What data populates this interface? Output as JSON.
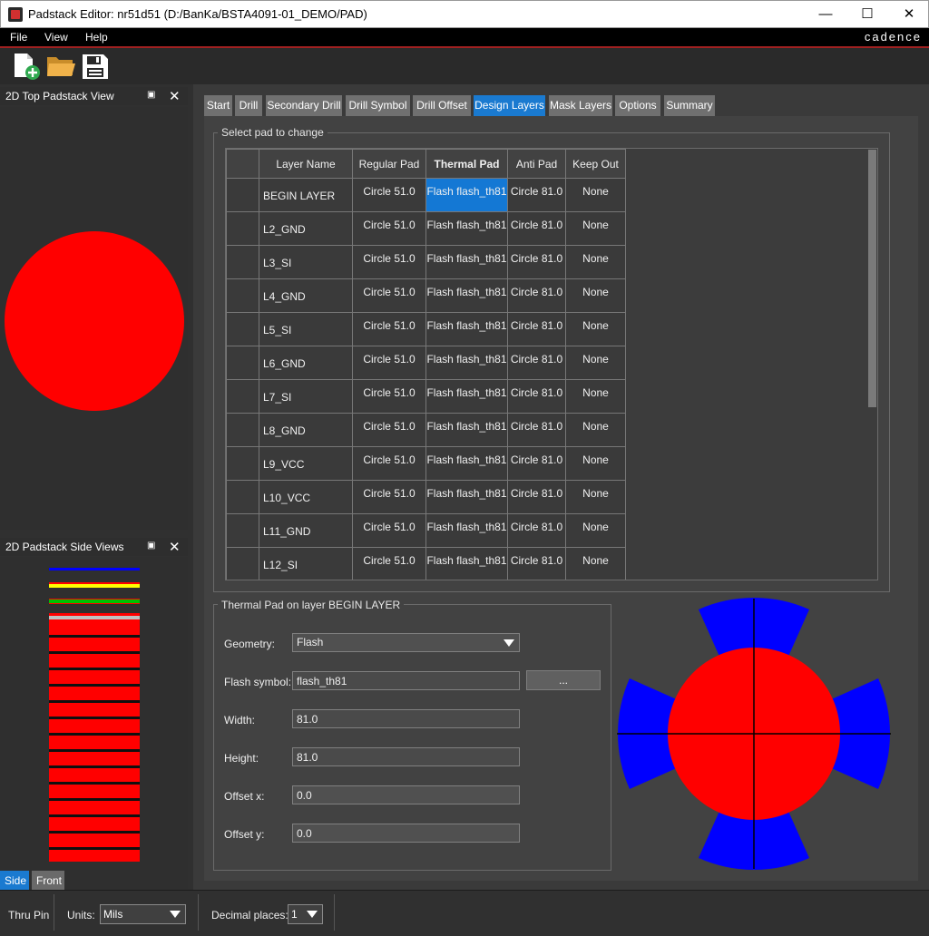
{
  "window": {
    "title": "Padstack Editor: nr51d51  (D:/BanKa/BSTA4091-01_DEMO/PAD)",
    "minimize": "—",
    "maximize": "☐",
    "close": "✕"
  },
  "menu": {
    "items": [
      "File",
      "View",
      "Help"
    ],
    "brand": "cadence"
  },
  "toolbar": {
    "icons": [
      "new-file-icon",
      "open-folder-icon",
      "save-icon"
    ]
  },
  "top_view": {
    "title": "2D Top Padstack View",
    "float_glyph": "▣",
    "close_glyph": "✕",
    "pad_color": "#ff0000"
  },
  "side_view": {
    "title": "2D Padstack Side Views",
    "float_glyph": "▣",
    "close_glyph": "✕",
    "tabs": [
      "Side",
      "Front"
    ],
    "active_tab": "Side",
    "layer_colors": [
      "#0000ff",
      "#ffff00",
      "#00c000",
      "#c0c0c0",
      "#ff0000"
    ]
  },
  "tabs": [
    "Start",
    "Drill",
    "Secondary Drill",
    "Drill Symbol",
    "Drill Offset",
    "Design Layers",
    "Mask Layers",
    "Options",
    "Summary"
  ],
  "active_tab": "Design Layers",
  "pad_group": {
    "title": "Select pad to change",
    "columns": [
      "",
      "Layer Name",
      "Regular Pad",
      "Thermal Pad",
      "Anti Pad",
      "Keep Out"
    ],
    "rows": [
      {
        "layer": "BEGIN LAYER",
        "regular": "Circle 51.0",
        "thermal": "Flash flash_th81",
        "anti": "Circle 81.0",
        "keepout": "None"
      },
      {
        "layer": "L2_GND",
        "regular": "Circle 51.0",
        "thermal": "Flash flash_th81",
        "anti": "Circle 81.0",
        "keepout": "None"
      },
      {
        "layer": "L3_SI",
        "regular": "Circle 51.0",
        "thermal": "Flash flash_th81",
        "anti": "Circle 81.0",
        "keepout": "None"
      },
      {
        "layer": "L4_GND",
        "regular": "Circle 51.0",
        "thermal": "Flash flash_th81",
        "anti": "Circle 81.0",
        "keepout": "None"
      },
      {
        "layer": "L5_SI",
        "regular": "Circle 51.0",
        "thermal": "Flash flash_th81",
        "anti": "Circle 81.0",
        "keepout": "None"
      },
      {
        "layer": "L6_GND",
        "regular": "Circle 51.0",
        "thermal": "Flash flash_th81",
        "anti": "Circle 81.0",
        "keepout": "None"
      },
      {
        "layer": "L7_SI",
        "regular": "Circle 51.0",
        "thermal": "Flash flash_th81",
        "anti": "Circle 81.0",
        "keepout": "None"
      },
      {
        "layer": "L8_GND",
        "regular": "Circle 51.0",
        "thermal": "Flash flash_th81",
        "anti": "Circle 81.0",
        "keepout": "None"
      },
      {
        "layer": "L9_VCC",
        "regular": "Circle 51.0",
        "thermal": "Flash flash_th81",
        "anti": "Circle 81.0",
        "keepout": "None"
      },
      {
        "layer": "L10_VCC",
        "regular": "Circle 51.0",
        "thermal": "Flash flash_th81",
        "anti": "Circle 81.0",
        "keepout": "None"
      },
      {
        "layer": "L11_GND",
        "regular": "Circle 51.0",
        "thermal": "Flash flash_th81",
        "anti": "Circle 81.0",
        "keepout": "None"
      },
      {
        "layer": "L12_SI",
        "regular": "Circle 51.0",
        "thermal": "Flash flash_th81",
        "anti": "Circle 81.0",
        "keepout": "None"
      }
    ],
    "selected_row": 0,
    "selected_col": "thermal"
  },
  "thermal_group": {
    "title": "Thermal Pad on layer BEGIN LAYER",
    "geometry_label": "Geometry:",
    "geometry_value": "Flash",
    "flash_label": "Flash symbol:",
    "flash_value": "flash_th81",
    "browse_label": "...",
    "width_label": "Width:",
    "width_value": "81.0",
    "height_label": "Height:",
    "height_value": "81.0",
    "offx_label": "Offset x:",
    "offx_value": "0.0",
    "offy_label": "Offset y:",
    "offy_value": "0.0"
  },
  "preview": {
    "pad_color": "#ff0000",
    "spoke_color": "#0000ff",
    "crosshair_color": "#000000"
  },
  "status": {
    "mode": "Thru Pin",
    "units_label": "Units:",
    "units_value": "Mils",
    "decimal_label": "Decimal places:",
    "decimal_value": "1"
  }
}
